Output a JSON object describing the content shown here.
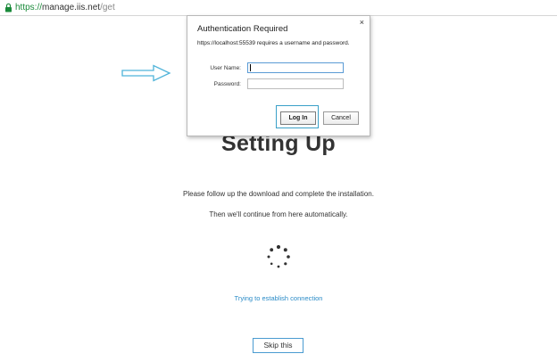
{
  "browser": {
    "url_scheme": "https://",
    "url_host": "manage.iis.net",
    "url_path": "/get",
    "secure_color": "#1a8a3a"
  },
  "page": {
    "title": "Setting Up",
    "instruction_1": "Please follow up the download and complete the installation.",
    "instruction_2": "Then we'll continue from here automatically.",
    "status_link": "Trying to establish connection",
    "skip_label": "Skip this",
    "link_color": "#2a8bc7",
    "spinner_icon": "loading-spinner-icon"
  },
  "annotation": {
    "arrow_icon": "right-arrow-outline-icon",
    "arrow_color": "#4fb3d9"
  },
  "auth_dialog": {
    "title": "Authentication Required",
    "close_glyph": "×",
    "message": "https://localhost:55539 requires a username and password.",
    "username_label": "User Name:",
    "username_value": "",
    "password_label": "Password:",
    "password_value": "",
    "login_label": "Log In",
    "cancel_label": "Cancel"
  }
}
